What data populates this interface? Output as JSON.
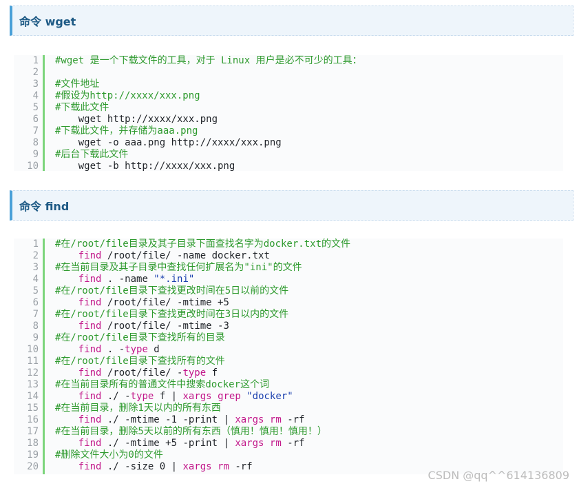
{
  "section1": {
    "title": "命令 wget",
    "lines": [
      [
        [
          "c",
          "#wget 是一个下载文件的工具，对于 Linux 用户是必不可少的工具："
        ]
      ],
      [],
      [
        [
          "c",
          "#文件地址"
        ]
      ],
      [
        [
          "c",
          "#假设为http://xxxx/xxx.png"
        ]
      ],
      [
        [
          "c",
          "#下载此文件"
        ]
      ],
      [
        [
          "p",
          "    wget http://xxxx/xxx.png"
        ]
      ],
      [
        [
          "c",
          "#下载此文件，并存储为aaa.png"
        ]
      ],
      [
        [
          "p",
          "    wget -o aaa.png http://xxxx/xxx.png"
        ]
      ],
      [
        [
          "c",
          "#后台下载此文件"
        ]
      ],
      [
        [
          "p",
          "    wget -b http://xxxx/xxx.png"
        ]
      ]
    ]
  },
  "section2": {
    "title": "命令 find",
    "lines": [
      [
        [
          "c",
          "#在/root/file目录及其子目录下面查找名字为docker.txt的文件"
        ]
      ],
      [
        [
          "p",
          "    "
        ],
        [
          "k",
          "find"
        ],
        [
          "p",
          " /root/file/ -name docker.txt"
        ]
      ],
      [
        [
          "c",
          "#在当前目录及其子目录中查找任何扩展名为\"ini\"的文件"
        ]
      ],
      [
        [
          "p",
          "    "
        ],
        [
          "k",
          "find"
        ],
        [
          "p",
          " . -name "
        ],
        [
          "s",
          "\"*.ini\""
        ]
      ],
      [
        [
          "c",
          "#在/root/file目录下查找更改时间在5日以前的文件"
        ]
      ],
      [
        [
          "p",
          "    "
        ],
        [
          "k",
          "find"
        ],
        [
          "p",
          " /root/file/ -mtime +5"
        ]
      ],
      [
        [
          "c",
          "#在/root/file目录下查找更改时间在3日以内的文件"
        ]
      ],
      [
        [
          "p",
          "    "
        ],
        [
          "k",
          "find"
        ],
        [
          "p",
          " /root/file/ -mtime -3"
        ]
      ],
      [
        [
          "c",
          "#在/root/file目录下查找所有的目录"
        ]
      ],
      [
        [
          "p",
          "    "
        ],
        [
          "k",
          "find"
        ],
        [
          "p",
          " . -"
        ],
        [
          "k",
          "type"
        ],
        [
          "p",
          " d"
        ]
      ],
      [
        [
          "c",
          "#在/root/file目录下查找所有的文件"
        ]
      ],
      [
        [
          "p",
          "    "
        ],
        [
          "k",
          "find"
        ],
        [
          "p",
          " /root/file/ -"
        ],
        [
          "k",
          "type"
        ],
        [
          "p",
          " f"
        ]
      ],
      [
        [
          "c",
          "#在当前目录所有的普通文件中搜索docker这个词"
        ]
      ],
      [
        [
          "p",
          "    "
        ],
        [
          "k",
          "find"
        ],
        [
          "p",
          " ./ -"
        ],
        [
          "k",
          "type"
        ],
        [
          "p",
          " f | "
        ],
        [
          "k",
          "xargs"
        ],
        [
          "p",
          " "
        ],
        [
          "k",
          "grep"
        ],
        [
          "p",
          " "
        ],
        [
          "s",
          "\"docker\""
        ]
      ],
      [
        [
          "c",
          "#在当前目录，删除1天以内的所有东西"
        ]
      ],
      [
        [
          "p",
          "    "
        ],
        [
          "k",
          "find"
        ],
        [
          "p",
          " ./ -mtime -1 -print | "
        ],
        [
          "k",
          "xargs"
        ],
        [
          "p",
          " "
        ],
        [
          "k",
          "rm"
        ],
        [
          "p",
          " -rf"
        ]
      ],
      [
        [
          "c",
          "#在当前目录，删除5天以前的所有东西（慎用！慎用！慎用！）"
        ]
      ],
      [
        [
          "p",
          "    "
        ],
        [
          "k",
          "find"
        ],
        [
          "p",
          " ./ -mtime +5 -print | "
        ],
        [
          "k",
          "xargs"
        ],
        [
          "p",
          " "
        ],
        [
          "k",
          "rm"
        ],
        [
          "p",
          " -rf"
        ]
      ],
      [
        [
          "c",
          "#删除文件大小为0的文件"
        ]
      ],
      [
        [
          "p",
          "    "
        ],
        [
          "k",
          "find"
        ],
        [
          "p",
          " ./ -size 0 | "
        ],
        [
          "k",
          "xargs"
        ],
        [
          "p",
          " "
        ],
        [
          "k",
          "rm"
        ],
        [
          "p",
          " -rf"
        ]
      ]
    ]
  },
  "watermark": "CSDN @qq^^614136809"
}
